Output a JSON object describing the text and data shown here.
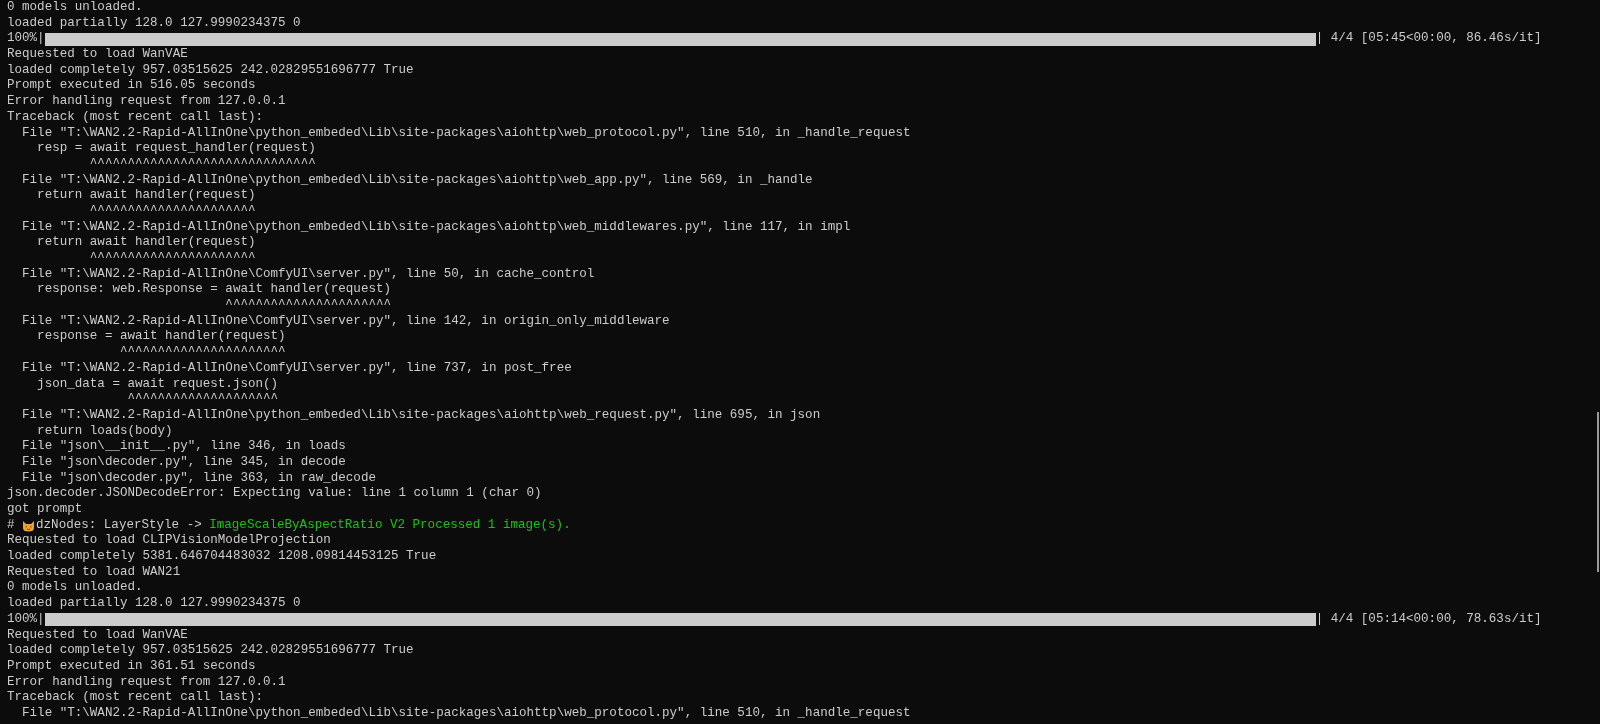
{
  "lines": [
    {
      "kind": "text",
      "text": "0 models unloaded."
    },
    {
      "kind": "text",
      "text": "loaded partially 128.0 127.9990234375 0"
    },
    {
      "kind": "progress",
      "prefix": "100%|",
      "level": 1,
      "suffix": "| 4/4 [05:45<00:00, 86.46s/it]"
    },
    {
      "kind": "text",
      "text": "Requested to load WanVAE"
    },
    {
      "kind": "text",
      "text": "loaded completely 957.03515625 242.02829551696777 True"
    },
    {
      "kind": "text",
      "text": "Prompt executed in 516.05 seconds"
    },
    {
      "kind": "text",
      "text": "Error handling request from 127.0.0.1"
    },
    {
      "kind": "text",
      "text": "Traceback (most recent call last):"
    },
    {
      "kind": "text",
      "text": "  File \"T:\\WAN2.2-Rapid-AllInOne\\python_embeded\\Lib\\site-packages\\aiohttp\\web_protocol.py\", line 510, in _handle_request"
    },
    {
      "kind": "text",
      "text": "    resp = await request_handler(request)"
    },
    {
      "kind": "caret",
      "text": "           ^^^^^^^^^^^^^^^^^^^^^^^^^^^^^^"
    },
    {
      "kind": "text",
      "text": "  File \"T:\\WAN2.2-Rapid-AllInOne\\python_embeded\\Lib\\site-packages\\aiohttp\\web_app.py\", line 569, in _handle"
    },
    {
      "kind": "text",
      "text": "    return await handler(request)"
    },
    {
      "kind": "caret",
      "text": "           ^^^^^^^^^^^^^^^^^^^^^^"
    },
    {
      "kind": "text",
      "text": "  File \"T:\\WAN2.2-Rapid-AllInOne\\python_embeded\\Lib\\site-packages\\aiohttp\\web_middlewares.py\", line 117, in impl"
    },
    {
      "kind": "text",
      "text": "    return await handler(request)"
    },
    {
      "kind": "caret",
      "text": "           ^^^^^^^^^^^^^^^^^^^^^^"
    },
    {
      "kind": "text",
      "text": "  File \"T:\\WAN2.2-Rapid-AllInOne\\ComfyUI\\server.py\", line 50, in cache_control"
    },
    {
      "kind": "text",
      "text": "    response: web.Response = await handler(request)"
    },
    {
      "kind": "caret",
      "text": "                             ^^^^^^^^^^^^^^^^^^^^^^"
    },
    {
      "kind": "text",
      "text": "  File \"T:\\WAN2.2-Rapid-AllInOne\\ComfyUI\\server.py\", line 142, in origin_only_middleware"
    },
    {
      "kind": "text",
      "text": "    response = await handler(request)"
    },
    {
      "kind": "caret",
      "text": "               ^^^^^^^^^^^^^^^^^^^^^^"
    },
    {
      "kind": "text",
      "text": "  File \"T:\\WAN2.2-Rapid-AllInOne\\ComfyUI\\server.py\", line 737, in post_free"
    },
    {
      "kind": "text",
      "text": "    json_data = await request.json()"
    },
    {
      "kind": "caret",
      "text": "                ^^^^^^^^^^^^^^^^^^^^"
    },
    {
      "kind": "text",
      "text": "  File \"T:\\WAN2.2-Rapid-AllInOne\\python_embeded\\Lib\\site-packages\\aiohttp\\web_request.py\", line 695, in json"
    },
    {
      "kind": "text",
      "text": "    return loads(body)"
    },
    {
      "kind": "text",
      "text": "  File \"json\\__init__.py\", line 346, in loads"
    },
    {
      "kind": "text",
      "text": "  File \"json\\decoder.py\", line 345, in decode"
    },
    {
      "kind": "text",
      "text": "  File \"json\\decoder.py\", line 363, in raw_decode"
    },
    {
      "kind": "text",
      "text": "json.decoder.JSONDecodeError: Expecting value: line 1 column 1 (char 0)"
    },
    {
      "kind": "text",
      "text": "got prompt"
    },
    {
      "kind": "styled",
      "segments": [
        {
          "kind": "text",
          "text": "# "
        },
        {
          "kind": "icon"
        },
        {
          "kind": "text",
          "text": "dzNodes: LayerStyle -> "
        },
        {
          "kind": "text",
          "text": "ImageScaleByAspectRatio V2 Processed 1 image(s).",
          "color": "#16c60c"
        }
      ]
    },
    {
      "kind": "text",
      "text": "Requested to load CLIPVisionModelProjection"
    },
    {
      "kind": "text",
      "text": "loaded completely 5381.646704483032 1208.09814453125 True"
    },
    {
      "kind": "text",
      "text": "Requested to load WAN21"
    },
    {
      "kind": "text",
      "text": "0 models unloaded."
    },
    {
      "kind": "text",
      "text": "loaded partially 128.0 127.9990234375 0"
    },
    {
      "kind": "progress",
      "prefix": "100%|",
      "level": 1,
      "suffix": "| 4/4 [05:14<00:00, 78.63s/it]"
    },
    {
      "kind": "text",
      "text": "Requested to load WanVAE"
    },
    {
      "kind": "text",
      "text": "loaded completely 957.03515625 242.02829551696777 True"
    },
    {
      "kind": "text",
      "text": "Prompt executed in 361.51 seconds"
    },
    {
      "kind": "text",
      "text": "Error handling request from 127.0.0.1"
    },
    {
      "kind": "text",
      "text": "Traceback (most recent call last):"
    },
    {
      "kind": "text",
      "text": "  File \"T:\\WAN2.2-Rapid-AllInOne\\python_embeded\\Lib\\site-packages\\aiohttp\\web_protocol.py\", line 510, in _handle_request"
    }
  ]
}
